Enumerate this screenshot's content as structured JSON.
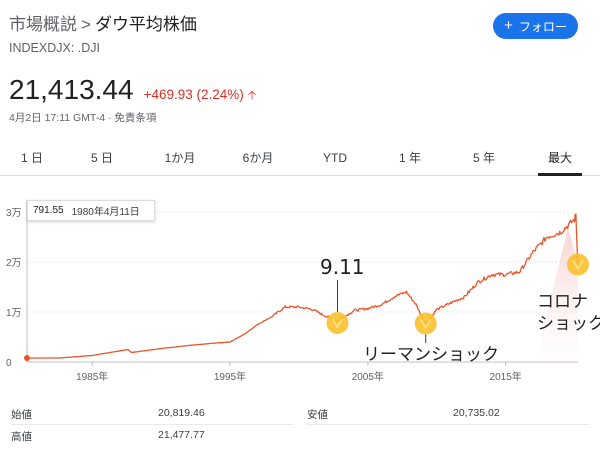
{
  "header": {
    "breadcrumb_market": "市場概説",
    "breadcrumb_sep": ">",
    "breadcrumb_title": "ダウ平均株価",
    "ticker": "INDEXDJX: .DJI",
    "follow_label": "フォロー",
    "follow_icon": "plus-icon",
    "accent_color": "#1a73e8"
  },
  "quote": {
    "price": "21,413.44",
    "change": "+469.93 (2.24%)",
    "change_icon": "arrow-up-icon",
    "change_color": "#d93025",
    "meta": "4月2日 17:11 GMT-4 · 免責条項"
  },
  "tabs": [
    {
      "label": "1 日"
    },
    {
      "label": "5 日"
    },
    {
      "label": "1か月"
    },
    {
      "label": "6か月"
    },
    {
      "label": "YTD"
    },
    {
      "label": "1 年"
    },
    {
      "label": "5 年"
    },
    {
      "label": "最大",
      "active": true
    }
  ],
  "tooltip": {
    "value": "791.55",
    "date": "1980年4月11日"
  },
  "annotations": {
    "event_911": "9.11",
    "event_lehman": "リーマンショック",
    "event_corona_1": "コロナ",
    "event_corona_2": "ショック",
    "highlight_color": "#fbc02d"
  },
  "chart_data": {
    "type": "area",
    "line_color": "#e8562a",
    "x_ticks": [
      "1985年",
      "1995年",
      "2005年",
      "2015年"
    ],
    "y_ticks": [
      "3万",
      "2万",
      "1万",
      "0"
    ],
    "x_range": [
      1980.27,
      2020.25
    ],
    "ylim": [
      0,
      30000
    ],
    "x": [
      1980.27,
      1982.6,
      1985,
      1987.6,
      1987.85,
      1990,
      1992,
      1994,
      1995,
      1996,
      1997,
      1998,
      1999,
      2000,
      2001,
      2001.7,
      2002.8,
      2004,
      2005,
      2006,
      2007,
      2007.8,
      2008.5,
      2009.2,
      2010,
      2011,
      2012,
      2013,
      2014,
      2015,
      2016,
      2017,
      2018,
      2019,
      2020,
      2020.1,
      2020.2,
      2020.25
    ],
    "values": [
      792,
      800,
      1300,
      2500,
      1900,
      2700,
      3300,
      3800,
      4000,
      5500,
      7500,
      9000,
      11000,
      11000,
      10500,
      9500,
      8200,
      10300,
      10700,
      11500,
      13200,
      14000,
      11500,
      7500,
      10500,
      11800,
      13000,
      16000,
      17500,
      17500,
      18000,
      22000,
      25000,
      26000,
      28500,
      29500,
      22000,
      19500
    ],
    "markers": [
      {
        "label": "9.11",
        "x": 2002.8,
        "y": 7800
      },
      {
        "label": "リーマンショック",
        "x": 2009.2,
        "y": 7700
      },
      {
        "label": "コロナショック",
        "x": 2020.25,
        "y": 19500
      }
    ]
  },
  "stats": {
    "open_label": "始値",
    "open_value": "20,819.46",
    "low_label": "安値",
    "low_value": "20,735.02",
    "high_label": "高値",
    "high_value": "21,477.77"
  }
}
